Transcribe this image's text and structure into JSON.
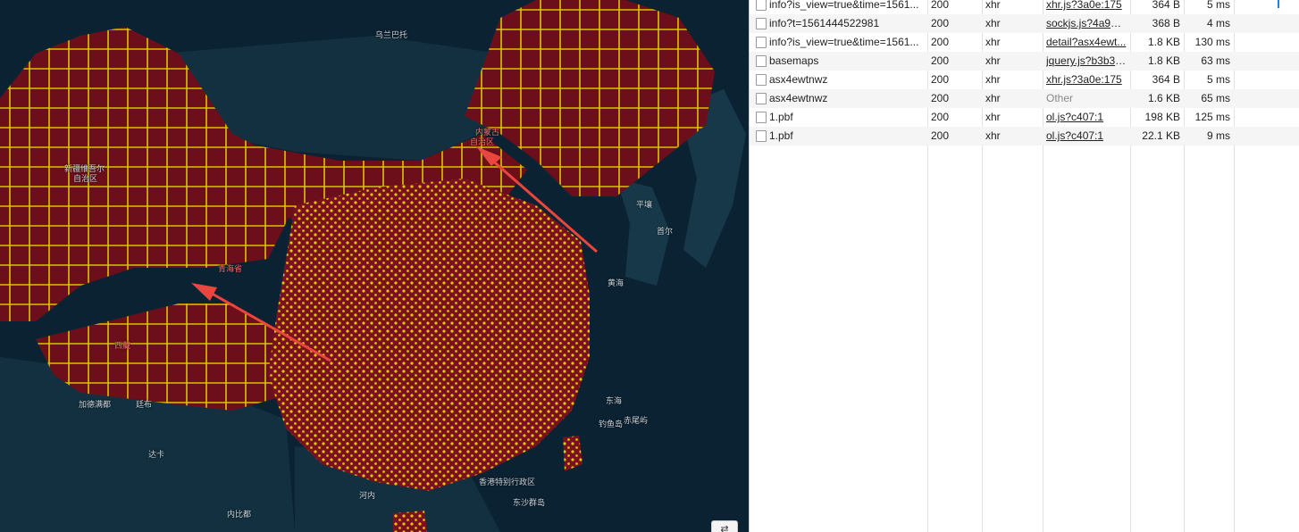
{
  "map": {
    "labels": [
      {
        "id": "russia",
        "text": "乌兰巴托"
      },
      {
        "id": "xinjiang-1",
        "text": "新疆维吾尔"
      },
      {
        "id": "xinjiang-2",
        "text": "自治区"
      },
      {
        "id": "neimeng-1",
        "text": "内蒙古"
      },
      {
        "id": "neimeng-2",
        "text": "自治区"
      },
      {
        "id": "pyongyang",
        "text": "平壤"
      },
      {
        "id": "seoul",
        "text": "首尔"
      },
      {
        "id": "yellow-sea",
        "text": "黄海"
      },
      {
        "id": "qinghai",
        "text": "青海省"
      },
      {
        "id": "tibet",
        "text": "西藏"
      },
      {
        "id": "kathmandu",
        "text": "加德满都"
      },
      {
        "id": "thimphu",
        "text": "廷布"
      },
      {
        "id": "east-sea",
        "text": "东海"
      },
      {
        "id": "ryukyu",
        "text": "钓鱼岛"
      },
      {
        "id": "chiwei",
        "text": "赤尾屿"
      },
      {
        "id": "dhaka",
        "text": "达卡"
      },
      {
        "id": "hongkong",
        "text": "香港特别行政区"
      },
      {
        "id": "hanoi",
        "text": "河内"
      },
      {
        "id": "dongsha",
        "text": "东沙群岛"
      },
      {
        "id": "naypyidaw",
        "text": "内比都"
      }
    ],
    "control_label": "⇄"
  },
  "network": {
    "rows": [
      {
        "name": "info?is_view=true&time=1561...",
        "status": "200",
        "type": "xhr",
        "initiator": "xhr.js?3a0e:175",
        "initiator_link": true,
        "size": "364 B",
        "time": "5 ms"
      },
      {
        "name": "info?t=1561444522981",
        "status": "200",
        "type": "xhr",
        "initiator": "sockjs.js?4a94:...",
        "initiator_link": true,
        "size": "368 B",
        "time": "4 ms"
      },
      {
        "name": "info?is_view=true&time=1561...",
        "status": "200",
        "type": "xhr",
        "initiator": "detail?asx4ewt...",
        "initiator_link": true,
        "size": "1.8 KB",
        "time": "130 ms"
      },
      {
        "name": "basemaps",
        "status": "200",
        "type": "xhr",
        "initiator": "jquery.js?b3b3:...",
        "initiator_link": true,
        "size": "1.8 KB",
        "time": "63 ms"
      },
      {
        "name": "asx4ewtnwz",
        "status": "200",
        "type": "xhr",
        "initiator": "xhr.js?3a0e:175",
        "initiator_link": true,
        "size": "364 B",
        "time": "5 ms"
      },
      {
        "name": "asx4ewtnwz",
        "status": "200",
        "type": "xhr",
        "initiator": "Other",
        "initiator_link": false,
        "size": "1.6 KB",
        "time": "65 ms"
      },
      {
        "name": "1.pbf",
        "status": "200",
        "type": "xhr",
        "initiator": "ol.js?c407:1",
        "initiator_link": true,
        "size": "198 KB",
        "time": "125 ms"
      },
      {
        "name": "1.pbf",
        "status": "200",
        "type": "xhr",
        "initiator": "ol.js?c407:1",
        "initiator_link": true,
        "size": "22.1 KB",
        "time": "9 ms"
      }
    ]
  },
  "colors": {
    "ocean": "#0b2233",
    "land_highlight": "#6d0f1a",
    "boundary": "#d8c400",
    "arrow": "#e8463f"
  }
}
